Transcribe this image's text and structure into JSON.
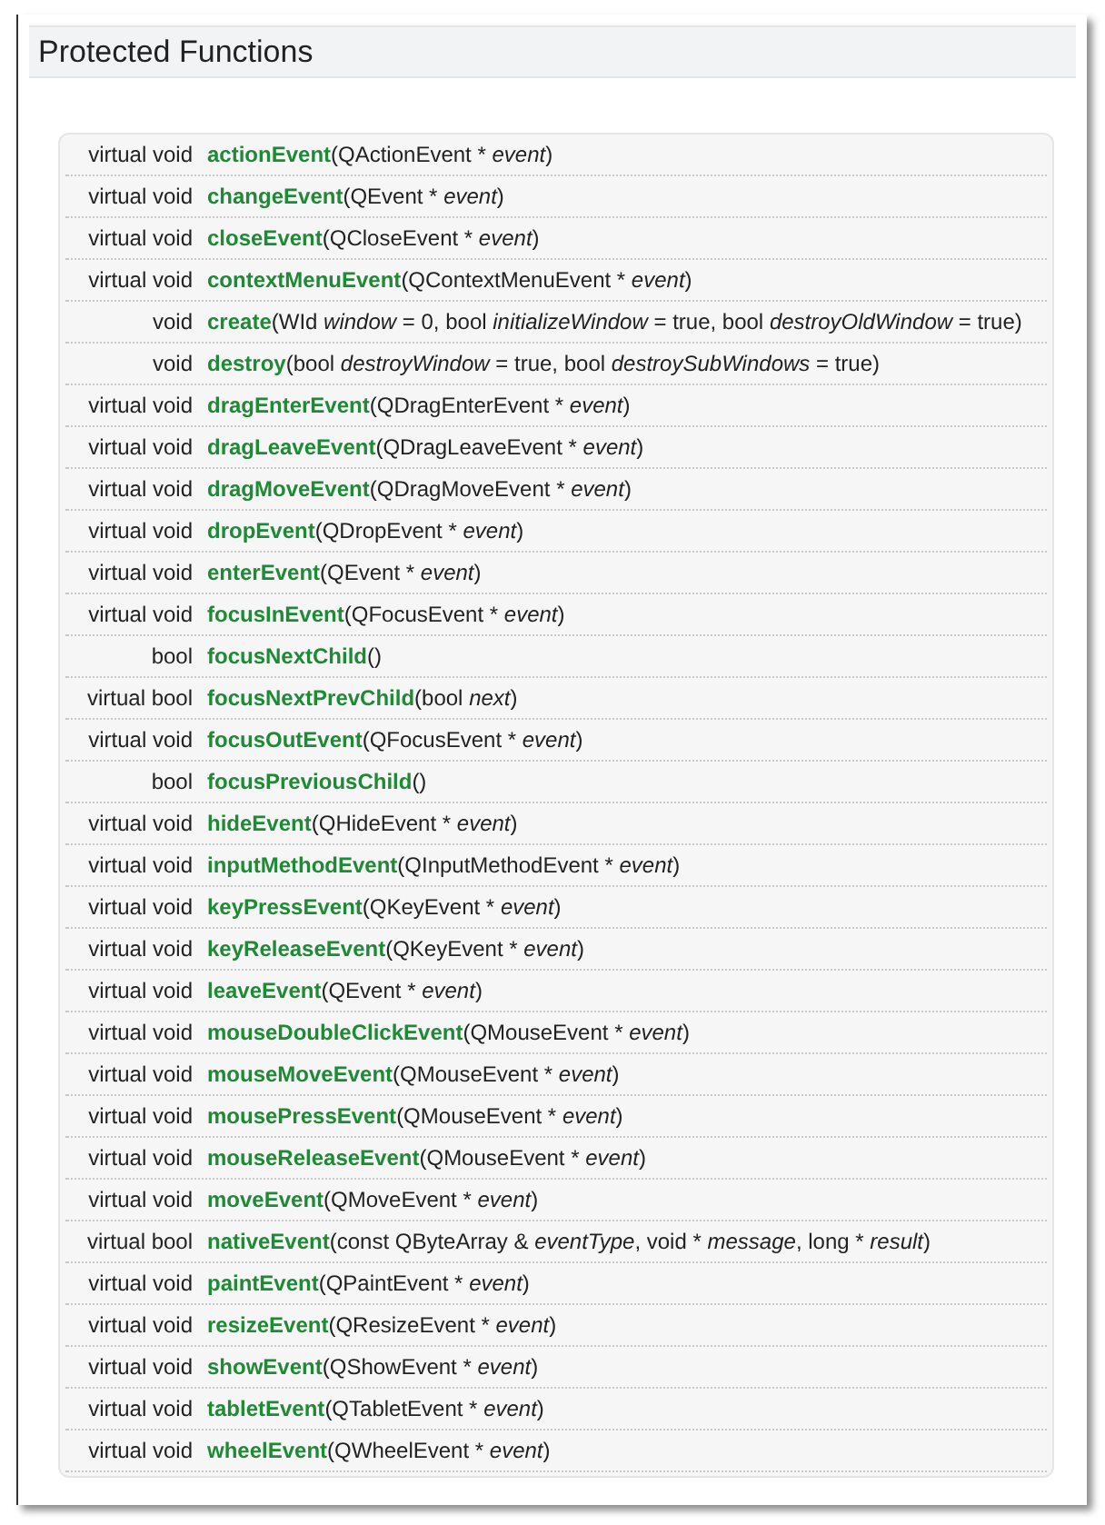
{
  "section": {
    "title": "Protected Functions"
  },
  "functions": [
    {
      "type": "virtual void",
      "name": "actionEvent",
      "params": "(QActionEvent * *event*)"
    },
    {
      "type": "virtual void",
      "name": "changeEvent",
      "params": "(QEvent * *event*)"
    },
    {
      "type": "virtual void",
      "name": "closeEvent",
      "params": "(QCloseEvent * *event*)"
    },
    {
      "type": "virtual void",
      "name": "contextMenuEvent",
      "params": "(QContextMenuEvent * *event*)"
    },
    {
      "type": "void",
      "name": "create",
      "params": "(WId *window* = 0, bool *initializeWindow* = true, bool *destroyOldWindow* = true)"
    },
    {
      "type": "void",
      "name": "destroy",
      "params": "(bool *destroyWindow* = true, bool *destroySubWindows* = true)"
    },
    {
      "type": "virtual void",
      "name": "dragEnterEvent",
      "params": "(QDragEnterEvent * *event*)"
    },
    {
      "type": "virtual void",
      "name": "dragLeaveEvent",
      "params": "(QDragLeaveEvent * *event*)"
    },
    {
      "type": "virtual void",
      "name": "dragMoveEvent",
      "params": "(QDragMoveEvent * *event*)"
    },
    {
      "type": "virtual void",
      "name": "dropEvent",
      "params": "(QDropEvent * *event*)"
    },
    {
      "type": "virtual void",
      "name": "enterEvent",
      "params": "(QEvent * *event*)"
    },
    {
      "type": "virtual void",
      "name": "focusInEvent",
      "params": "(QFocusEvent * *event*)"
    },
    {
      "type": "bool",
      "name": "focusNextChild",
      "params": "()"
    },
    {
      "type": "virtual bool",
      "name": "focusNextPrevChild",
      "params": "(bool *next*)"
    },
    {
      "type": "virtual void",
      "name": "focusOutEvent",
      "params": "(QFocusEvent * *event*)"
    },
    {
      "type": "bool",
      "name": "focusPreviousChild",
      "params": "()"
    },
    {
      "type": "virtual void",
      "name": "hideEvent",
      "params": "(QHideEvent * *event*)"
    },
    {
      "type": "virtual void",
      "name": "inputMethodEvent",
      "params": "(QInputMethodEvent * *event*)"
    },
    {
      "type": "virtual void",
      "name": "keyPressEvent",
      "params": "(QKeyEvent * *event*)"
    },
    {
      "type": "virtual void",
      "name": "keyReleaseEvent",
      "params": "(QKeyEvent * *event*)"
    },
    {
      "type": "virtual void",
      "name": "leaveEvent",
      "params": "(QEvent * *event*)"
    },
    {
      "type": "virtual void",
      "name": "mouseDoubleClickEvent",
      "params": "(QMouseEvent * *event*)"
    },
    {
      "type": "virtual void",
      "name": "mouseMoveEvent",
      "params": "(QMouseEvent * *event*)"
    },
    {
      "type": "virtual void",
      "name": "mousePressEvent",
      "params": "(QMouseEvent * *event*)"
    },
    {
      "type": "virtual void",
      "name": "mouseReleaseEvent",
      "params": "(QMouseEvent * *event*)"
    },
    {
      "type": "virtual void",
      "name": "moveEvent",
      "params": "(QMoveEvent * *event*)"
    },
    {
      "type": "virtual bool",
      "name": "nativeEvent",
      "params": "(const QByteArray & *eventType*, void * *message*, long * *result*)"
    },
    {
      "type": "virtual void",
      "name": "paintEvent",
      "params": "(QPaintEvent * *event*)"
    },
    {
      "type": "virtual void",
      "name": "resizeEvent",
      "params": "(QResizeEvent * *event*)"
    },
    {
      "type": "virtual void",
      "name": "showEvent",
      "params": "(QShowEvent * *event*)"
    },
    {
      "type": "virtual void",
      "name": "tabletEvent",
      "params": "(QTabletEvent * *event*)"
    },
    {
      "type": "virtual void",
      "name": "wheelEvent",
      "params": "(QWheelEvent * *event*)"
    }
  ]
}
